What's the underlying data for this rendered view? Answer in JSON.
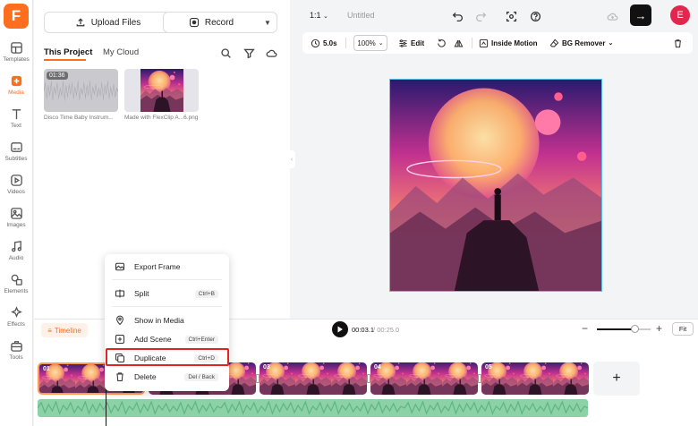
{
  "app": {
    "logo_letter": "F"
  },
  "rail": {
    "items": [
      {
        "label": "Templates",
        "icon": "templates-icon"
      },
      {
        "label": "Media",
        "icon": "media-icon",
        "active": true
      },
      {
        "label": "Text",
        "icon": "text-icon"
      },
      {
        "label": "Subtitles",
        "icon": "subtitles-icon"
      },
      {
        "label": "Videos",
        "icon": "videos-icon"
      },
      {
        "label": "Images",
        "icon": "images-icon"
      },
      {
        "label": "Audio",
        "icon": "audio-icon"
      },
      {
        "label": "Elements",
        "icon": "elements-icon"
      },
      {
        "label": "Effects",
        "icon": "effects-icon"
      },
      {
        "label": "Tools",
        "icon": "tools-icon"
      }
    ]
  },
  "media_panel": {
    "upload_label": "Upload Files",
    "record_label": "Record",
    "tabs": [
      {
        "label": "This Project",
        "active": true
      },
      {
        "label": "My Cloud"
      }
    ],
    "assets": [
      {
        "duration": "01:36",
        "caption": "Disco Time Baby Instrum..."
      },
      {
        "caption": "Made with FlexClip A...6.png"
      }
    ]
  },
  "editor": {
    "aspect_ratio": "1:1",
    "title": "Untitled",
    "avatar_letter": "E",
    "toolbar": {
      "duration": "5.0s",
      "zoom": "100%",
      "edit_label": "Edit",
      "inside_motion_label": "Inside Motion",
      "bg_remover_label": "BG Remover"
    }
  },
  "timeline": {
    "label": "Timeline",
    "current_time": "00:03.1",
    "separator": "/",
    "total_time": "00:25.0",
    "fit_label": "Fit",
    "zoom_level": 0.7,
    "clips": [
      "01",
      "02",
      "03",
      "04",
      "05"
    ],
    "add_label": "+"
  },
  "context_menu": {
    "items": [
      {
        "label": "Export Frame",
        "shortcut": ""
      },
      {
        "label": "Split",
        "shortcut": "Ctrl+B"
      },
      {
        "label": "Show in Media",
        "shortcut": ""
      },
      {
        "label": "Add Scene",
        "shortcut": "Ctrl+Enter"
      },
      {
        "label": "Duplicate",
        "shortcut": "Ctrl+D",
        "highlighted": true
      },
      {
        "label": "Delete",
        "shortcut": "Del / Back"
      }
    ]
  },
  "colors": {
    "accent": "#ff6d1f",
    "highlight": "#e02424",
    "audio_track": "#8dd1a7",
    "avatar": "#e2264d"
  }
}
